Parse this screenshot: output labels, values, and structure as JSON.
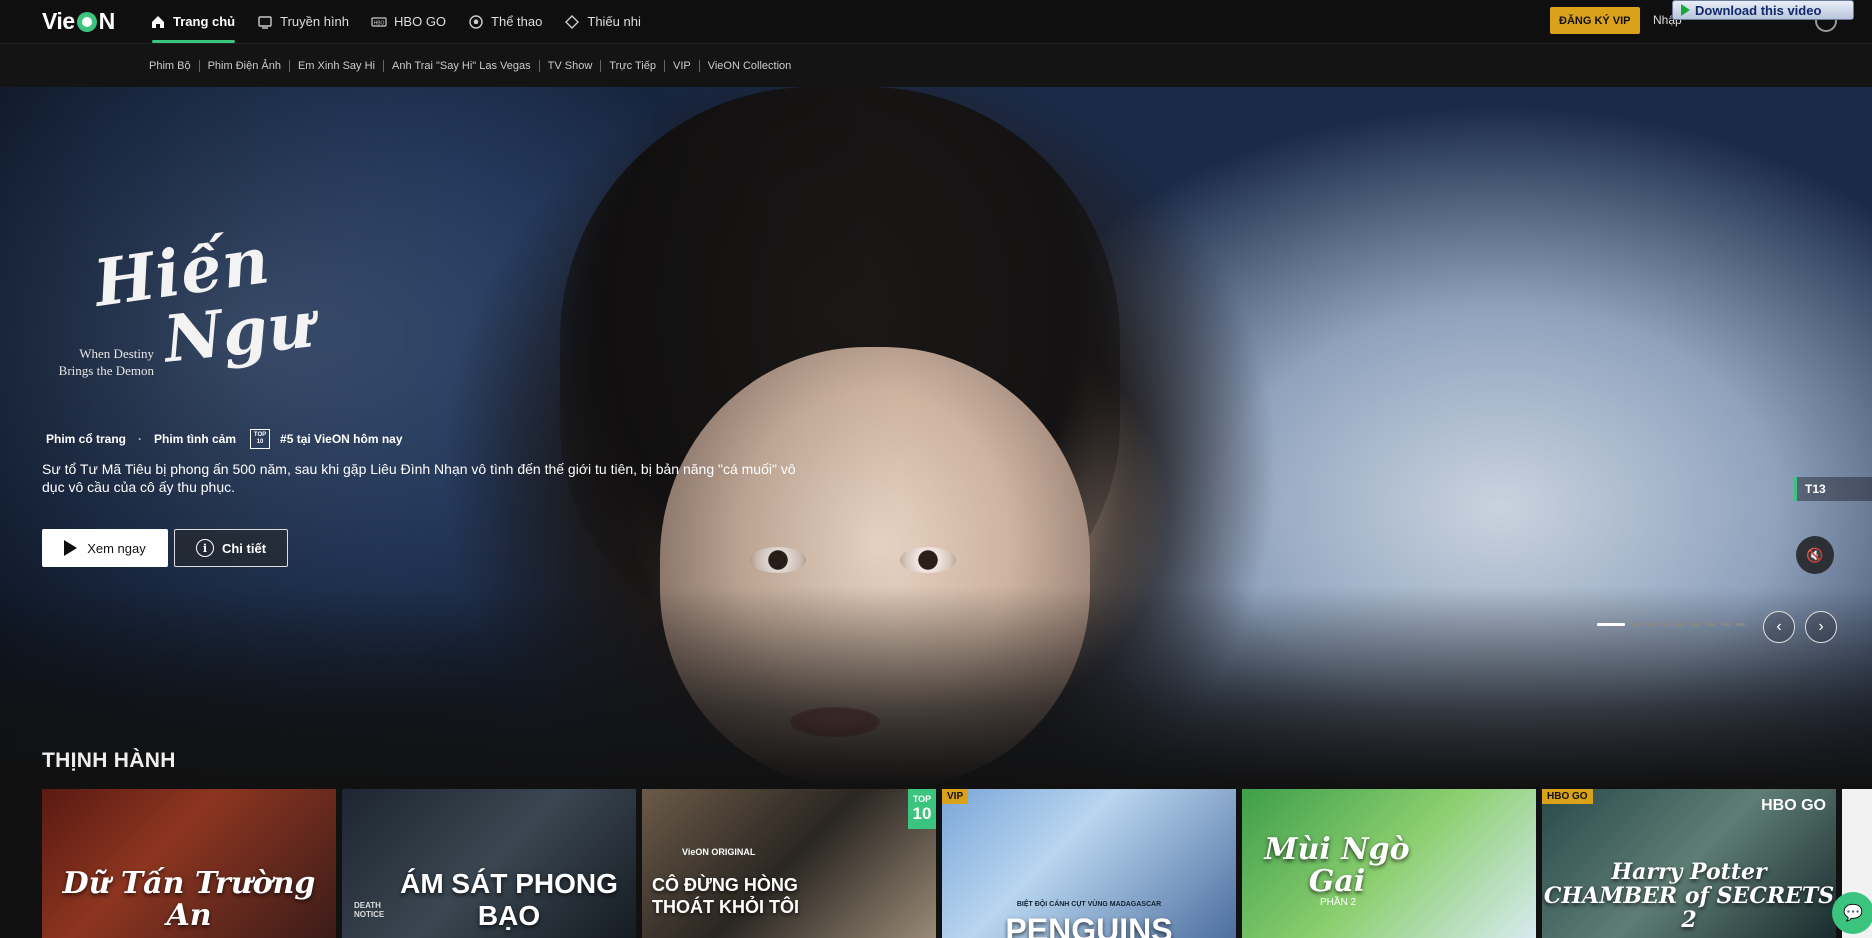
{
  "header": {
    "logo": {
      "text_a": "Vie",
      "text_b": "N"
    },
    "nav": [
      {
        "label": "Trang chủ",
        "icon": "home-icon",
        "active": true
      },
      {
        "label": "Truyền hình",
        "icon": "tv-icon"
      },
      {
        "label": "HBO GO",
        "icon": "hbo-icon"
      },
      {
        "label": "Thể thao",
        "icon": "ball-icon"
      },
      {
        "label": "Thiếu nhi",
        "icon": "kids-icon"
      }
    ],
    "vip_button": "ĐĂNG KÝ VIP",
    "login": "Nhập",
    "download_button": "Download this video"
  },
  "subnav": [
    "Phim Bộ",
    "Phim Điện Ảnh",
    "Em Xinh Say Hi",
    "Anh Trai \"Say Hi\" Las Vegas",
    "TV Show",
    "Trực Tiếp",
    "VIP",
    "VieON Collection"
  ],
  "hero": {
    "title_line1": "Hiến",
    "title_line2": "Ngư",
    "subtitle_line1": "When Destiny",
    "subtitle_line2": "Brings the Demon",
    "genre1": "Phim cổ trang",
    "genre_sep": "·",
    "genre2": "Phim tình cảm",
    "top10_badge_line1": "TOP",
    "top10_badge_line2": "10",
    "rank_text": "#5 tại VieON hôm nay",
    "description": "Sư tổ Tư Mã Tiêu bị phong ấn 500 năm, sau khi gặp Liêu Đình Nhạn vô tình đến thế giới tu tiên, bị bản năng \"cá muối\" vô dục vô cầu của cô ấy thu phục.",
    "watch_button": "Xem ngay",
    "detail_button": "Chi tiết",
    "detail_icon_glyph": "i",
    "rating": "T13",
    "mute_glyph": "🔇",
    "prev_glyph": "‹",
    "next_glyph": "›",
    "carousel_count": 9,
    "carousel_active": 0
  },
  "trending": {
    "title": "THỊNH HÀNH",
    "cards": [
      {
        "title": "Dữ Tấn Trường An",
        "style": "serif"
      },
      {
        "title": "ÁM SÁT PHONG BẠO",
        "style": "sans",
        "pre": "DEATH NOTICE"
      },
      {
        "title": "CÔ ĐỪNG HÒNG THOÁT KHỎI TÔI",
        "style": "sans",
        "pre": "VieON ORIGINAL",
        "top10_line1": "TOP",
        "top10_line2": "10"
      },
      {
        "title": "PENGUINS",
        "style": "sans",
        "badge": "VIP",
        "pre": "BIỆT ĐỘI CÁNH CỤT VÙNG MADAGASCAR"
      },
      {
        "title": "Mùi Ngò Gai",
        "style": "serif",
        "pre": "PHẦN 2"
      },
      {
        "title": "Harry Potter CHAMBER of SECRETS 2",
        "style": "serif",
        "badge": "HBO GO",
        "hbo": "HBO GO"
      }
    ]
  },
  "chat_icon_glyph": "💬"
}
